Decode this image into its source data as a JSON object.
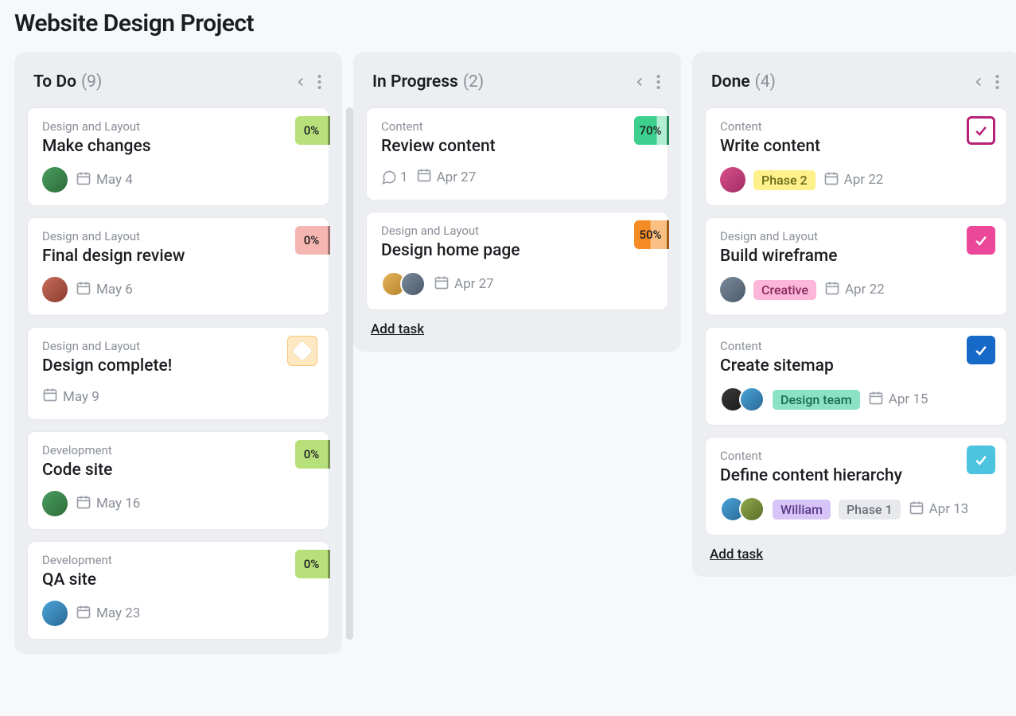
{
  "page_title": "Website Design Project",
  "add_task_label": "Add task",
  "columns": [
    {
      "title": "To Do",
      "count": "(9)",
      "show_scroll": true,
      "show_add_task": false,
      "cards": [
        {
          "category": "Design and Layout",
          "title": "Make changes",
          "badge": {
            "type": "pct",
            "text": "0%",
            "bg": "#b8e07a",
            "mark": true
          },
          "avatars": [
            "av-a"
          ],
          "date": "May 4"
        },
        {
          "category": "Design and Layout",
          "title": "Final design review",
          "badge": {
            "type": "pct",
            "text": "0%",
            "bg": "#f5b5b0",
            "mark": true
          },
          "avatars": [
            "av-b"
          ],
          "date": "May 6"
        },
        {
          "category": "Design and Layout",
          "title": "Design complete!",
          "badge": {
            "type": "milestone"
          },
          "avatars": [],
          "date": "May 9"
        },
        {
          "category": "Development",
          "title": "Code site",
          "badge": {
            "type": "pct",
            "text": "0%",
            "bg": "#b8e07a",
            "mark": true
          },
          "avatars": [
            "av-a"
          ],
          "date": "May 16"
        },
        {
          "category": "Development",
          "title": "QA site",
          "badge": {
            "type": "pct",
            "text": "0%",
            "bg": "#b8e07a",
            "mark": true
          },
          "avatars": [
            "av-e"
          ],
          "date": "May 23"
        }
      ]
    },
    {
      "title": "In Progress",
      "count": "(2)",
      "show_scroll": false,
      "show_add_task": true,
      "cards": [
        {
          "category": "Content",
          "title": "Review content",
          "badge": {
            "type": "pct70",
            "text": "70%"
          },
          "avatars": [],
          "comments": "1",
          "date": "Apr 27"
        },
        {
          "category": "Design and Layout",
          "title": "Design home page",
          "badge": {
            "type": "pct50",
            "text": "50%"
          },
          "avatars": [
            "av-h",
            "av-d"
          ],
          "date": "Apr 27"
        }
      ]
    },
    {
      "title": "Done",
      "count": "(4)",
      "show_scroll": false,
      "show_add_task": true,
      "cards": [
        {
          "category": "Content",
          "title": "Write content",
          "badge": {
            "type": "check",
            "bg": "#b8217a",
            "outline": true
          },
          "avatars": [
            "av-c"
          ],
          "tags": [
            {
              "text": "Phase 2",
              "bg": "#fef08a",
              "fg": "#6b6b1a"
            }
          ],
          "date": "Apr 22"
        },
        {
          "category": "Design and Layout",
          "title": "Build wireframe",
          "badge": {
            "type": "check",
            "bg": "#ec4899"
          },
          "avatars": [
            "av-d"
          ],
          "tags": [
            {
              "text": "Creative",
              "bg": "#fbb6d9",
              "fg": "#8a2a5a"
            }
          ],
          "date": "Apr 22"
        },
        {
          "category": "Content",
          "title": "Create sitemap",
          "badge": {
            "type": "check",
            "bg": "#1769c7"
          },
          "avatars": [
            "av-f",
            "av-e"
          ],
          "tags": [
            {
              "text": "Design team",
              "bg": "#8ce2c4",
              "fg": "#1a6b4f"
            }
          ],
          "date": "Apr 15"
        },
        {
          "category": "Content",
          "title": "Define content hierarchy",
          "badge": {
            "type": "check",
            "bg": "#4cc4e0"
          },
          "avatars": [
            "av-e",
            "av-g"
          ],
          "tags": [
            {
              "text": "William",
              "bg": "#d8c5f7",
              "fg": "#5a3a8a"
            },
            {
              "text": "Phase 1",
              "bg": "#e8e9ec",
              "fg": "#6b6f78"
            }
          ],
          "date": "Apr 13"
        }
      ]
    }
  ]
}
